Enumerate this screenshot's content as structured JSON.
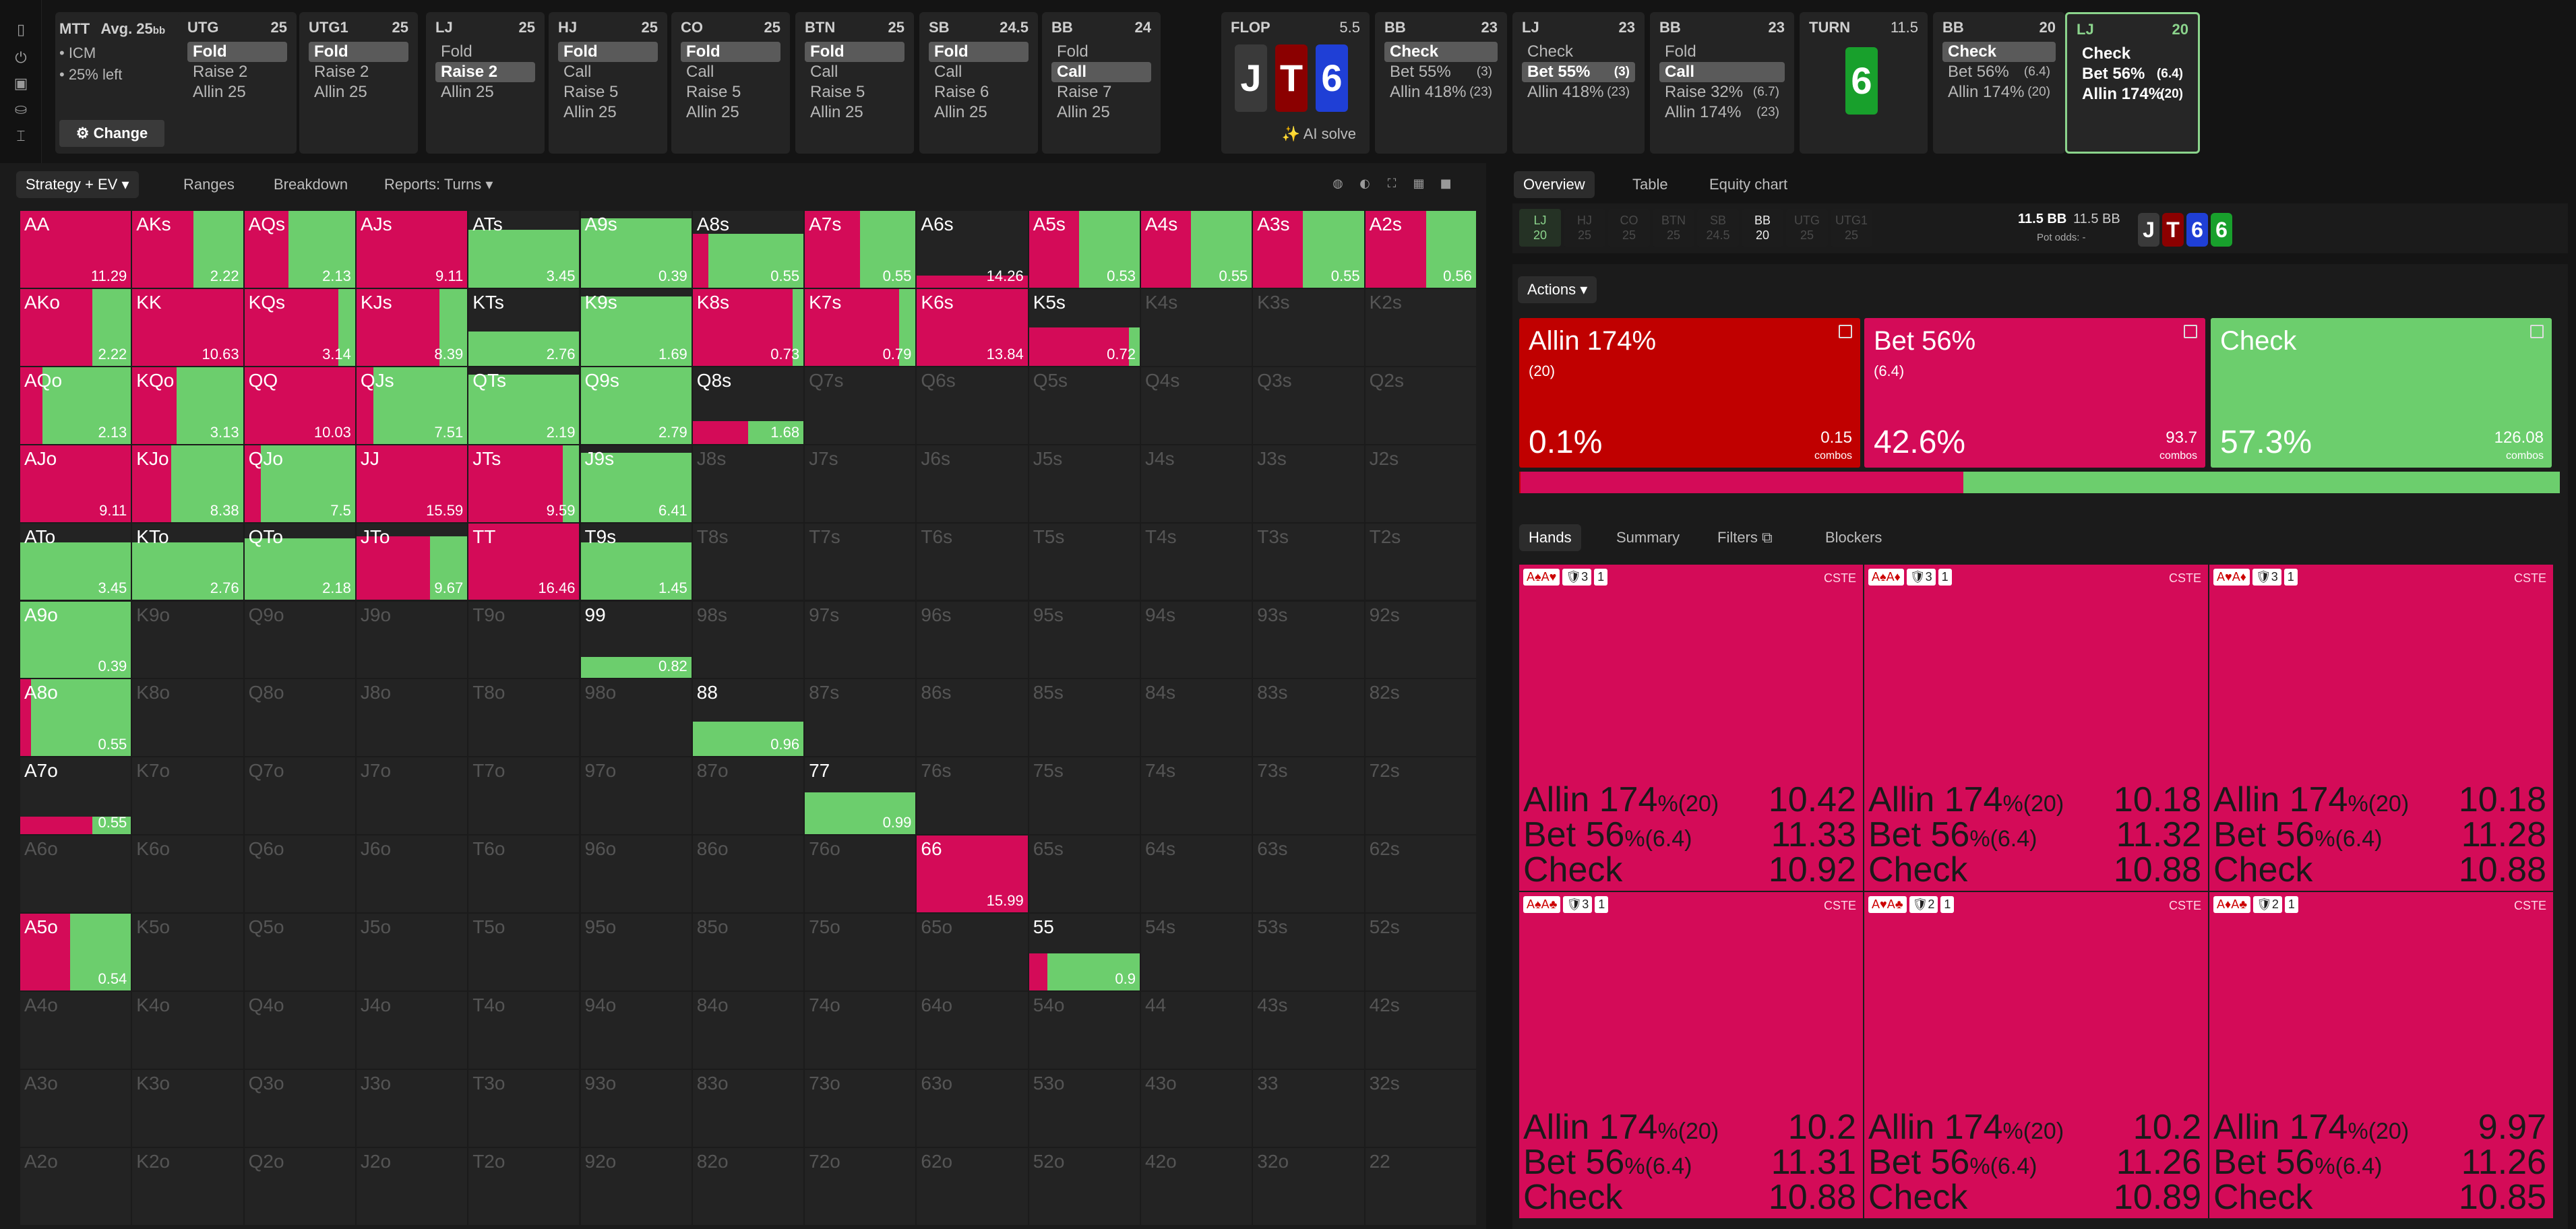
{
  "mtt": {
    "title": "MTT",
    "avg": "Avg. 25",
    "avg_unit": "bb",
    "line1": "• ICM",
    "line2": "• 25% left",
    "change_label": "⚙ Change"
  },
  "nodes": [
    {
      "pos": "UTG",
      "stack": "25",
      "actions": [
        {
          "t": "Fold",
          "s": true
        },
        {
          "t": "Raise 2"
        },
        {
          "t": "Allin 25"
        }
      ]
    },
    {
      "pos": "UTG1",
      "stack": "25",
      "actions": [
        {
          "t": "Fold",
          "s": true
        },
        {
          "t": "Raise 2"
        },
        {
          "t": "Allin 25"
        }
      ]
    },
    {
      "pos": "LJ",
      "stack": "25",
      "actions": [
        {
          "t": "Fold"
        },
        {
          "t": "Raise 2",
          "s": true
        },
        {
          "t": "Allin 25"
        }
      ]
    },
    {
      "pos": "HJ",
      "stack": "25",
      "actions": [
        {
          "t": "Fold",
          "s": true
        },
        {
          "t": "Call"
        },
        {
          "t": "Raise 5"
        },
        {
          "t": "Allin 25"
        }
      ]
    },
    {
      "pos": "CO",
      "stack": "25",
      "actions": [
        {
          "t": "Fold",
          "s": true
        },
        {
          "t": "Call"
        },
        {
          "t": "Raise 5"
        },
        {
          "t": "Allin 25"
        }
      ]
    },
    {
      "pos": "BTN",
      "stack": "25",
      "actions": [
        {
          "t": "Fold",
          "s": true
        },
        {
          "t": "Call"
        },
        {
          "t": "Raise 5"
        },
        {
          "t": "Allin 25"
        }
      ]
    },
    {
      "pos": "SB",
      "stack": "24.5",
      "actions": [
        {
          "t": "Fold",
          "s": true
        },
        {
          "t": "Call"
        },
        {
          "t": "Raise 6"
        },
        {
          "t": "Allin 25"
        }
      ]
    },
    {
      "pos": "BB",
      "stack": "24",
      "actions": [
        {
          "t": "Fold"
        },
        {
          "t": "Call",
          "s": true
        },
        {
          "t": "Raise 7"
        },
        {
          "t": "Allin 25"
        }
      ]
    }
  ],
  "flop": {
    "label": "FLOP",
    "pot": "5.5",
    "cards": [
      "J",
      "T",
      "6"
    ],
    "ai": "✨ AI solve"
  },
  "bb1": {
    "pos": "BB",
    "stack": "23",
    "actions": [
      {
        "t": "Check",
        "s": true
      },
      {
        "t": "Bet 55%",
        "c": "(3)"
      },
      {
        "t": "Allin 418%",
        "c": "(23)"
      }
    ]
  },
  "lj1": {
    "pos": "LJ",
    "stack": "23",
    "actions": [
      {
        "t": "Check"
      },
      {
        "t": "Bet 55%",
        "c": "(3)",
        "s": true
      },
      {
        "t": "Allin 418%",
        "c": "(23)"
      }
    ]
  },
  "bb2": {
    "pos": "BB",
    "stack": "23",
    "actions": [
      {
        "t": "Fold"
      },
      {
        "t": "Call",
        "s": true
      },
      {
        "t": "Raise 32%",
        "c": "(6.7)"
      },
      {
        "t": "Allin 174%",
        "c": "(23)"
      }
    ]
  },
  "turn": {
    "label": "TURN",
    "pot": "11.5",
    "card": "6"
  },
  "bb3": {
    "pos": "BB",
    "stack": "20",
    "actions": [
      {
        "t": "Check",
        "s": true
      },
      {
        "t": "Bet 56%",
        "c": "(6.4)"
      },
      {
        "t": "Allin 174%",
        "c": "(20)"
      }
    ]
  },
  "lj2": {
    "pos": "LJ",
    "stack": "20",
    "actions": [
      {
        "t": "Check"
      },
      {
        "t": "Bet 56%",
        "c": "(6.4)"
      },
      {
        "t": "Allin 174%",
        "c": "(20)"
      }
    ]
  },
  "left_tabs": [
    "Strategy + EV ▾",
    "Ranges",
    "Breakdown",
    "Reports: Turns ▾"
  ],
  "right_tabs": [
    "Overview",
    "Table",
    "Equity chart"
  ],
  "positions": [
    {
      "p": "LJ",
      "s": "20"
    },
    {
      "p": "HJ",
      "s": "25"
    },
    {
      "p": "CO",
      "s": "25"
    },
    {
      "p": "BTN",
      "s": "25"
    },
    {
      "p": "SB",
      "s": "24.5"
    },
    {
      "p": "BB",
      "s": "20"
    },
    {
      "p": "UTG",
      "s": "25"
    },
    {
      "p": "UTG1",
      "s": "25"
    }
  ],
  "pot": {
    "a": "11.5 BB",
    "b": "11.5 BB",
    "odds": "Pot odds:  -"
  },
  "board": [
    "J",
    "T",
    "6",
    "6"
  ],
  "actions_label": "Actions ▾",
  "actions": [
    {
      "name": "Allin 174%",
      "combos": "(20)",
      "pct": "0.1%",
      "val": "0.15",
      "unit": "combos",
      "color": "#c00000",
      "share": 0.001
    },
    {
      "name": "Bet 56%",
      "combos": "(6.4)",
      "pct": "42.6%",
      "val": "93.7",
      "unit": "combos",
      "color": "#d40b58",
      "share": 0.426
    },
    {
      "name": "Check",
      "combos": "",
      "pct": "57.3%",
      "val": "126.08",
      "unit": "combos",
      "color": "#6cce6d",
      "share": 0.573
    }
  ],
  "hand_tabs": [
    "Hands",
    "Summary",
    "Filters ⧉",
    "Blockers"
  ],
  "hand_cells": [
    {
      "cards": "A♠A♥",
      "b1": "🛡3",
      "b2": "1",
      "cste": "CSTE",
      "rows": [
        [
          "Allin 174",
          "%(20)",
          "10.42"
        ],
        [
          "Bet 56",
          "%(6.4)",
          "11.33"
        ],
        [
          "Check",
          "",
          "10.92"
        ]
      ]
    },
    {
      "cards": "A♠A♦",
      "b1": "🛡3",
      "b2": "1",
      "cste": "CSTE",
      "rows": [
        [
          "Allin 174",
          "%(20)",
          "10.18"
        ],
        [
          "Bet 56",
          "%(6.4)",
          "11.32"
        ],
        [
          "Check",
          "",
          "10.88"
        ]
      ]
    },
    {
      "cards": "A♥A♦",
      "b1": "🛡3",
      "b2": "1",
      "cste": "CSTE",
      "rows": [
        [
          "Allin 174",
          "%(20)",
          "10.18"
        ],
        [
          "Bet 56",
          "%(6.4)",
          "11.28"
        ],
        [
          "Check",
          "",
          "10.88"
        ]
      ]
    },
    {
      "cards": "A♠A♣",
      "b1": "🛡3",
      "b2": "1",
      "cste": "CSTE",
      "rows": [
        [
          "Allin 174",
          "%(20)",
          "10.2"
        ],
        [
          "Bet 56",
          "%(6.4)",
          "11.31"
        ],
        [
          "Check",
          "",
          "10.88"
        ]
      ]
    },
    {
      "cards": "A♥A♣",
      "b1": "🛡2",
      "b2": "1",
      "cste": "CSTE",
      "rows": [
        [
          "Allin 174",
          "%(20)",
          "10.2"
        ],
        [
          "Bet 56",
          "%(6.4)",
          "11.26"
        ],
        [
          "Check",
          "",
          "10.89"
        ]
      ]
    },
    {
      "cards": "A♦A♣",
      "b1": "🛡2",
      "b2": "1",
      "cste": "CSTE",
      "rows": [
        [
          "Allin 174",
          "%(20)",
          "9.97"
        ],
        [
          "Bet 56",
          "%(6.4)",
          "11.26"
        ],
        [
          "Check",
          "",
          "10.85"
        ]
      ]
    }
  ],
  "ranks": [
    "A",
    "K",
    "Q",
    "J",
    "T",
    "9",
    "8",
    "7",
    "6",
    "5",
    "4",
    "3",
    "2"
  ],
  "matrix": {
    "AA": {
      "r": 1.0,
      "g": 0.0,
      "ev": "11.29"
    },
    "AKs": {
      "r": 0.55,
      "g": 0.45,
      "ev": "2.22"
    },
    "AQs": {
      "r": 0.4,
      "g": 0.6,
      "ev": "2.13"
    },
    "AJs": {
      "r": 1.0,
      "g": 0.0,
      "ev": "9.11"
    },
    "ATs": {
      "r": 0.0,
      "g": 0.75,
      "ev": "3.45"
    },
    "A9s": {
      "r": 0.0,
      "g": 0.9,
      "ev": "0.39"
    },
    "A8s": {
      "r": 0.1,
      "g": 0.6,
      "ev": "0.55"
    },
    "A7s": {
      "r": 0.5,
      "g": 0.5,
      "ev": "0.55"
    },
    "A6s": {
      "r": 0.15,
      "g": 0.0,
      "ev": "14.26"
    },
    "A5s": {
      "r": 0.45,
      "g": 0.55,
      "ev": "0.53"
    },
    "A4s": {
      "r": 0.45,
      "g": 0.55,
      "ev": "0.55"
    },
    "A3s": {
      "r": 0.45,
      "g": 0.55,
      "ev": "0.55"
    },
    "A2s": {
      "r": 0.55,
      "g": 0.45,
      "ev": "0.56"
    },
    "AKo": {
      "r": 0.65,
      "g": 0.35,
      "ev": "2.22"
    },
    "KK": {
      "r": 1.0,
      "g": 0.0,
      "ev": "10.63"
    },
    "KQs": {
      "r": 0.85,
      "g": 0.15,
      "ev": "3.14"
    },
    "KJs": {
      "r": 0.75,
      "g": 0.25,
      "ev": "8.39"
    },
    "KTs": {
      "r": 0.0,
      "g": 0.45,
      "ev": "2.76"
    },
    "K9s": {
      "r": 0.0,
      "g": 0.9,
      "ev": "1.69"
    },
    "K8s": {
      "r": 0.9,
      "g": 0.1,
      "ev": "0.73"
    },
    "K7s": {
      "r": 0.85,
      "g": 0.15,
      "ev": "0.79"
    },
    "K6s": {
      "r": 1.0,
      "g": 0.0,
      "ev": "13.84"
    },
    "K5s": {
      "r": 0.45,
      "g": 0.05,
      "ev": "0.72"
    },
    "AQo": {
      "r": 0.2,
      "g": 0.8,
      "ev": "2.13"
    },
    "KQo": {
      "r": 0.4,
      "g": 0.6,
      "ev": "3.13"
    },
    "QQ": {
      "r": 1.0,
      "g": 0.0,
      "ev": "10.03"
    },
    "QJs": {
      "r": 0.15,
      "g": 0.85,
      "ev": "7.51"
    },
    "QTs": {
      "r": 0.0,
      "g": 0.9,
      "ev": "2.19"
    },
    "Q9s": {
      "r": 0.0,
      "g": 0.95,
      "ev": "2.79"
    },
    "Q8s": {
      "r": 0.15,
      "g": 0.15,
      "ev": "1.68"
    },
    "AJo": {
      "r": 1.0,
      "g": 0.0,
      "ev": "9.11"
    },
    "KJo": {
      "r": 0.35,
      "g": 0.65,
      "ev": "8.38"
    },
    "QJo": {
      "r": 0.15,
      "g": 0.85,
      "ev": "7.5"
    },
    "JJ": {
      "r": 1.0,
      "g": 0.0,
      "ev": "15.59"
    },
    "JTs": {
      "r": 0.85,
      "g": 0.15,
      "ev": "9.59"
    },
    "J9s": {
      "r": 0.0,
      "g": 0.9,
      "ev": "6.41"
    },
    "ATo": {
      "r": 0.0,
      "g": 0.75,
      "ev": "3.45"
    },
    "KTo": {
      "r": 0.0,
      "g": 0.75,
      "ev": "2.76"
    },
    "QTo": {
      "r": 0.0,
      "g": 0.8,
      "ev": "2.18"
    },
    "JTo": {
      "r": 0.55,
      "g": 0.28,
      "ev": "9.67"
    },
    "TT": {
      "r": 1.0,
      "g": 0.0,
      "ev": "16.46"
    },
    "T9s": {
      "r": 0.0,
      "g": 0.75,
      "ev": "1.45"
    },
    "A9o": {
      "r": 0.0,
      "g": 1.0,
      "ev": "0.39"
    },
    "99": {
      "r": 0.0,
      "g": 0.28,
      "ev": "0.82"
    },
    "A8o": {
      "r": 0.1,
      "g": 0.9,
      "ev": "0.55"
    },
    "88": {
      "r": 0.0,
      "g": 0.45,
      "ev": "0.96"
    },
    "A7o": {
      "r": 0.15,
      "g": 0.08,
      "ev": "0.55"
    },
    "77": {
      "r": 0.0,
      "g": 0.55,
      "ev": "0.99"
    },
    "66": {
      "r": 1.0,
      "g": 0.0,
      "ev": "15.99"
    },
    "A5o": {
      "r": 0.45,
      "g": 0.55,
      "ev": "0.54"
    },
    "55": {
      "r": 0.08,
      "g": 0.4,
      "ev": "0.9"
    }
  }
}
